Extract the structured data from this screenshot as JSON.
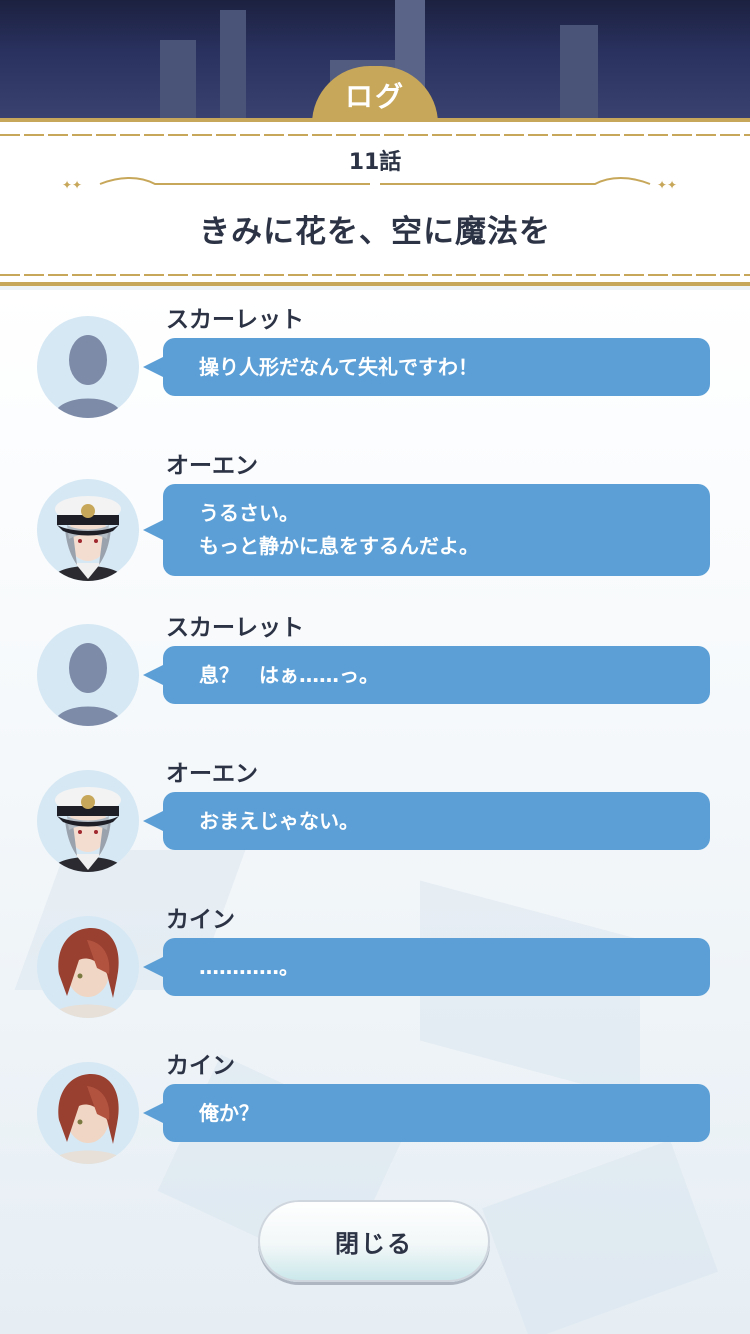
{
  "header": {
    "tab_label": "ログ",
    "episode": "11話",
    "chapter_title": "きみに花を、空に魔法を"
  },
  "log": [
    {
      "speaker": "スカーレット",
      "avatar": "silhouette",
      "lines": [
        "操り人形だなんて失礼ですわ！"
      ]
    },
    {
      "speaker": "オーエン",
      "avatar": "owen",
      "lines": [
        "うるさい。",
        "もっと静かに息をするんだよ。"
      ]
    },
    {
      "speaker": "スカーレット",
      "avatar": "silhouette",
      "lines": [
        "息？　はぁ……っ。"
      ]
    },
    {
      "speaker": "オーエン",
      "avatar": "owen",
      "lines": [
        "おまえじゃない。"
      ]
    },
    {
      "speaker": "カイン",
      "avatar": "cain",
      "lines": [
        "…………。"
      ]
    },
    {
      "speaker": "カイン",
      "avatar": "cain",
      "lines": [
        "俺か？"
      ]
    }
  ],
  "close_label": "閉じる",
  "colors": {
    "accent_gold": "#c7a759",
    "bubble_blue": "#5b9fd6",
    "text_dark": "#2c3345"
  }
}
